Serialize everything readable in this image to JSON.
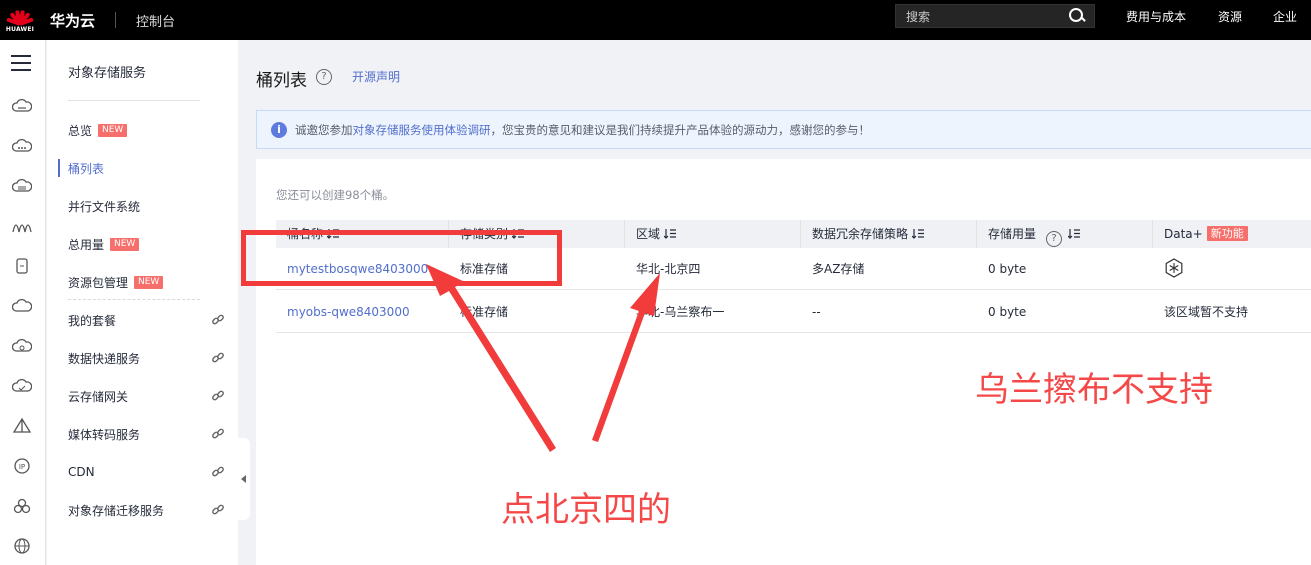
{
  "topbar": {
    "logo_text": "HUAWEI",
    "brand": "华为云",
    "console": "控制台",
    "search_placeholder": "搜索",
    "nav": [
      "费用与成本",
      "资源",
      "企业"
    ]
  },
  "sidebar": {
    "title": "对象存储服务",
    "items": [
      {
        "label": "总览",
        "badge": "NEW",
        "active": false
      },
      {
        "label": "桶列表",
        "badge": "",
        "active": true
      },
      {
        "label": "并行文件系统",
        "badge": "",
        "active": false
      },
      {
        "label": "总用量",
        "badge": "NEW",
        "active": false
      },
      {
        "label": "资源包管理",
        "badge": "NEW",
        "active": false
      },
      {
        "label": "我的套餐",
        "badge": "",
        "active": false,
        "external": true
      },
      {
        "label": "数据快递服务",
        "badge": "",
        "active": false,
        "external": true
      },
      {
        "label": "云存储网关",
        "badge": "",
        "active": false,
        "external": true
      },
      {
        "label": "媒体转码服务",
        "badge": "",
        "active": false,
        "external": true
      },
      {
        "label": "CDN",
        "badge": "",
        "active": false,
        "external": true
      },
      {
        "label": "对象存储迁移服务",
        "badge": "",
        "active": false,
        "external": true
      }
    ]
  },
  "main": {
    "title": "桶列表",
    "open_source": "开源声明",
    "info": {
      "prefix": "诚邀您参加",
      "link": "对象存储服务使用体验调研",
      "suffix": "，您宝贵的意见和建议是我们持续提升产品体验的源动力，感谢您的参与！"
    },
    "quota": "您还可以创建98个桶。",
    "table": {
      "headers": [
        "桶名称",
        "存储类别",
        "区域",
        "数据冗余存储策略",
        "存储用量",
        "Data+"
      ],
      "new_feature_badge": "新功能",
      "rows": [
        {
          "name": "mytestbosqwe8403000",
          "class": "标准存储",
          "region": "华北-北京四",
          "redundancy": "多AZ存储",
          "usage": "0 byte",
          "dataplus": "",
          "dataplus_icon": "snowflake-icon"
        },
        {
          "name": "myobs-qwe8403000",
          "class": "标准存储",
          "region": "华北-乌兰察布一",
          "redundancy": "--",
          "usage": "0 byte",
          "dataplus": "该区域暂不支持",
          "dataplus_icon": ""
        }
      ]
    }
  },
  "annotations": {
    "note_click": "点北京四的",
    "note_unsupported": "乌兰擦布不支持",
    "color": "#f23c3c"
  }
}
